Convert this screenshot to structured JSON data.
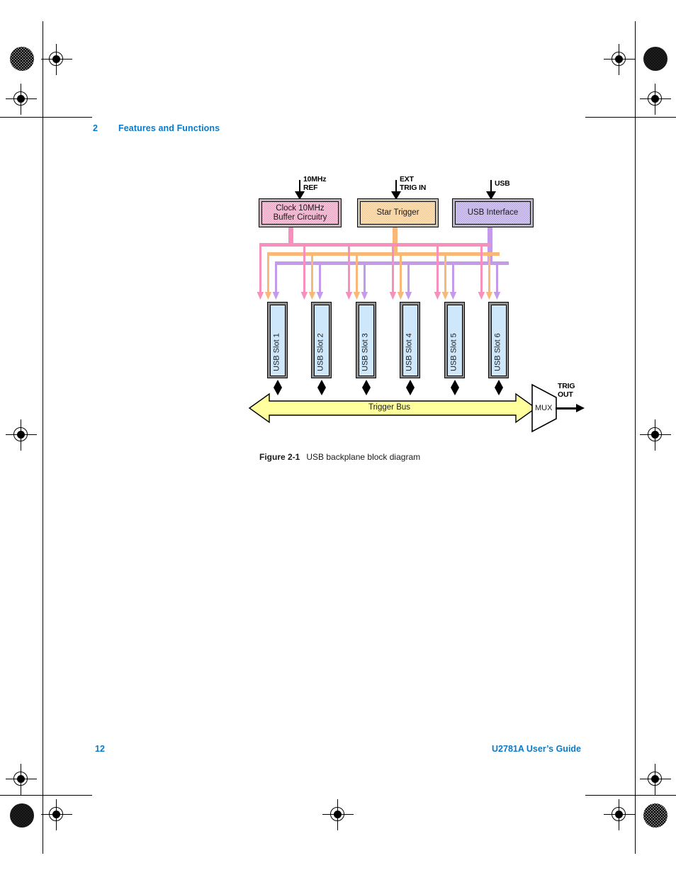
{
  "page": {
    "chapter_number": "2",
    "chapter_title": "Features and Functions",
    "page_number": "12",
    "manual_title": "U2781A User’s Guide",
    "accent_color": "#0a7ac8"
  },
  "figure": {
    "label": "Figure 2-1",
    "caption": "USB backplane block diagram",
    "inputs": [
      {
        "name": "clock-ref-input",
        "text": "10MHz\nREF"
      },
      {
        "name": "ext-trig-in-input",
        "text": "EXT\nTRIG IN"
      },
      {
        "name": "usb-input",
        "text": "USB"
      }
    ],
    "blocks": [
      {
        "name": "clock-buffer-block",
        "line1": "Clock 10MHz",
        "line2": "Buffer Circuitry",
        "color": "#f6cfe0"
      },
      {
        "name": "star-trigger-block",
        "line1": "Star Trigger",
        "line2": "",
        "color": "#fbe3c0"
      },
      {
        "name": "usb-interface-block",
        "line1": "USB Interface",
        "line2": "",
        "color": "#d8cdf0"
      }
    ],
    "slots": [
      "USB Slot 1",
      "USB Slot 2",
      "USB Slot 3",
      "USB Slot 4",
      "USB Slot 5",
      "USB Slot 6"
    ],
    "bus_label": "Trigger Bus",
    "bus_color": "#ffff9e",
    "mux_label": "MUX",
    "output_label": "TRIG\nOUT",
    "bus_line_colors": {
      "clock": "#f790bd",
      "star_trigger": "#f8b878",
      "usb": "#c49bea"
    }
  }
}
